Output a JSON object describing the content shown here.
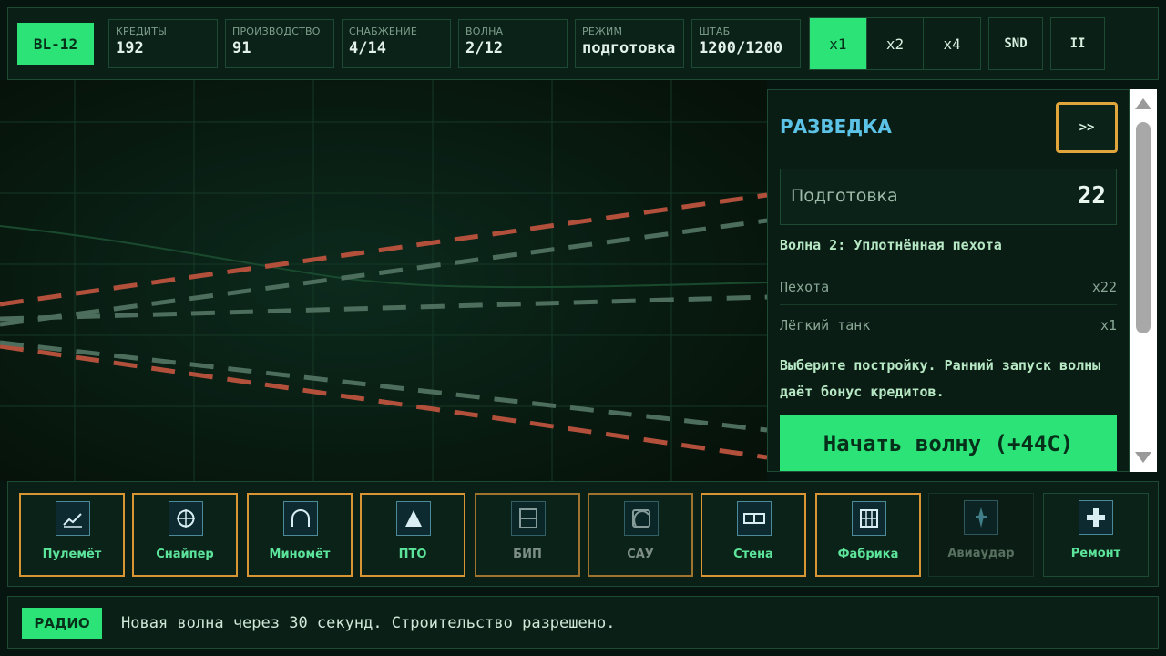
{
  "topbar": {
    "unit_id": "BL-12",
    "stats": [
      {
        "label": "КРЕДИТЫ",
        "value": "192"
      },
      {
        "label": "ПРОИЗВОДСТВО",
        "value": "91"
      },
      {
        "label": "СНАБЖЕНИЕ",
        "value": "4/14"
      },
      {
        "label": "ВОЛНА",
        "value": "2/12"
      },
      {
        "label": "РЕЖИМ",
        "value": "подготовка"
      },
      {
        "label": "ШТАБ",
        "value": "1200/1200"
      }
    ],
    "speeds": [
      {
        "label": "x1",
        "active": true
      },
      {
        "label": "x2",
        "active": false
      },
      {
        "label": "x4",
        "active": false
      }
    ],
    "sound_label": "SND",
    "pause_label": "II"
  },
  "panel": {
    "title": "РАЗВЕДКА",
    "collapse_label": ">>",
    "phase_label": "Подготовка",
    "phase_count": "22",
    "wave_name": "Волна 2: Уплотнённая пехота",
    "enemies": [
      {
        "name": "Пехота",
        "count": "x22"
      },
      {
        "name": "Лёгкий танк",
        "count": "x1"
      }
    ],
    "hint": "Выберите постройку. Ранний запуск волны даёт бонус кредитов.",
    "start_label": "Начать волну (+44C)"
  },
  "buildings": [
    {
      "label": "Пулемёт",
      "icon": "machine-gun-icon",
      "state": "available"
    },
    {
      "label": "Снайпер",
      "icon": "crosshair-icon",
      "state": "available"
    },
    {
      "label": "Миномёт",
      "icon": "mortar-arc-icon",
      "state": "available"
    },
    {
      "label": "ПТО",
      "icon": "anti-tank-icon",
      "state": "available"
    },
    {
      "label": "БИП",
      "icon": "command-post-icon",
      "state": "locked"
    },
    {
      "label": "САУ",
      "icon": "artillery-icon",
      "state": "locked"
    },
    {
      "label": "Стена",
      "icon": "wall-icon",
      "state": "available"
    },
    {
      "label": "Фабрика",
      "icon": "factory-icon",
      "state": "available"
    },
    {
      "label": "Авиаудар",
      "icon": "airstrike-icon",
      "state": "disabled"
    },
    {
      "label": "Ремонт",
      "icon": "repair-icon",
      "state": "normal"
    }
  ],
  "radio": {
    "tag": "РАДИО",
    "message": "Новая волна через 30 секунд. Строительство разрешено."
  },
  "colors": {
    "accent": "#2be377",
    "title": "#5cc3e6",
    "selected_border": "#e1a63b",
    "enemy_path": "#b2503c",
    "friendly_path": "#4d6e5c"
  }
}
